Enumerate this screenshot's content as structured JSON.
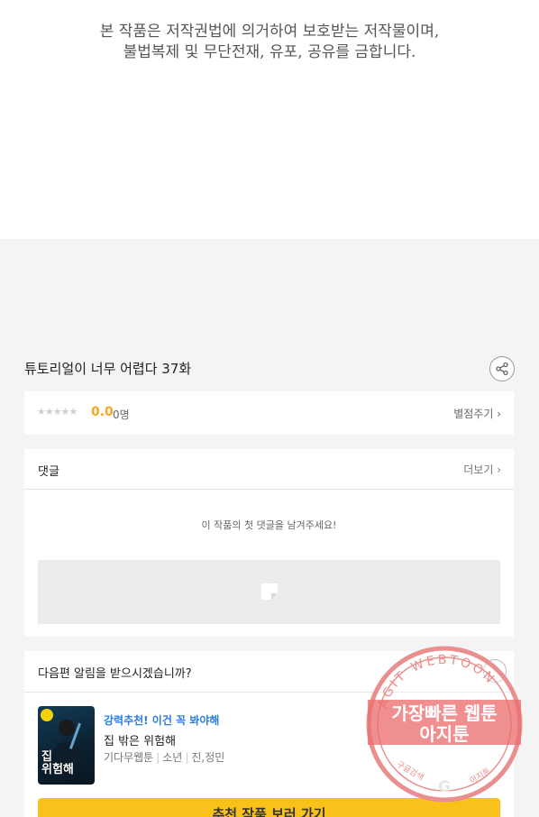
{
  "notice": {
    "line1": "본 작품은 저작권법에 의거하여 보호받는 저작물이며,",
    "line2": "불법복제 및 무단전재, 유포, 공유를 금합니다."
  },
  "episode": {
    "title": "튜토리얼이 너무 어렵다 37화"
  },
  "rating": {
    "stars": "★★★★★",
    "score": "0.0",
    "count": "0명",
    "rate_label": "별점주기 ›"
  },
  "comments": {
    "title": "댓글",
    "more_label": "더보기 ›",
    "empty_message": "이 작품의 첫 댓글을 남겨주세요!"
  },
  "alarm": {
    "question": "다음편 알림을 받으시겠습니까?"
  },
  "recommend": {
    "tag": "강력추천! 이건 꼭 봐야해",
    "name": "집 밖은 위험해",
    "genre": "기다무웹툰",
    "category": "소년",
    "authors": "진,정민",
    "thumb_line1": "집",
    "thumb_line2": "위험해",
    "button_label": "추천 작품 보러 가기"
  },
  "watermark": {
    "arc_text": "AGIT WEBTOON",
    "line1": "가장빠른 웹툰",
    "line2": "아지툰",
    "bottom_left": "구글검색",
    "bottom_right": "아지툰",
    "accent_color": "#e86a6a"
  }
}
